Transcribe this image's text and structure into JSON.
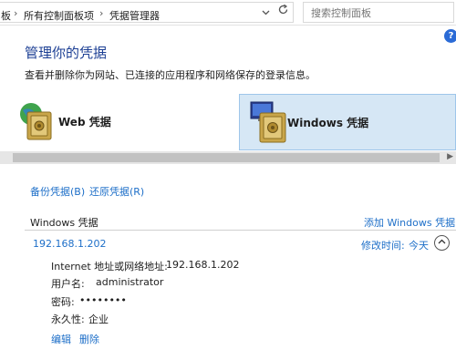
{
  "address_bar": {
    "crumbs": [
      "板",
      "所有控制面板项",
      "凭据管理器"
    ],
    "separator": "›",
    "dropdown_icon": "chevron-down-icon",
    "refresh_icon": "refresh-icon",
    "search_placeholder": "搜索控制面板",
    "search_icon": "search-icon"
  },
  "help": {
    "label": "?"
  },
  "page": {
    "title": "管理你的凭据",
    "description": "查看并删除你为网站、已连接的应用程序和网络保存的登录信息。"
  },
  "tiles": [
    {
      "label": "Web 凭据",
      "selected": false,
      "icon": "web-vault-icon"
    },
    {
      "label": "Windows 凭据",
      "selected": true,
      "icon": "windows-vault-icon"
    }
  ],
  "actions": {
    "backup": "备份凭据(B)",
    "restore": "还原凭据(R)"
  },
  "section": {
    "title": "Windows 凭据",
    "add_link": "添加 Windows 凭据"
  },
  "entry": {
    "host": "192.168.1.202",
    "modified_label": "修改时间:",
    "modified_value": "今天",
    "details": [
      {
        "label": "Internet 地址或网络地址:",
        "value": "192.168.1.202"
      },
      {
        "label": "用户名:",
        "value": "administrator"
      },
      {
        "label": "密码:",
        "value": "••••••••"
      },
      {
        "label": "永久性:",
        "value": "企业"
      }
    ],
    "edit": "编辑",
    "delete": "删除"
  },
  "colors": {
    "link": "#1e6fc8",
    "title": "#1c3f94",
    "selected_tile": "#d6e7f5"
  }
}
